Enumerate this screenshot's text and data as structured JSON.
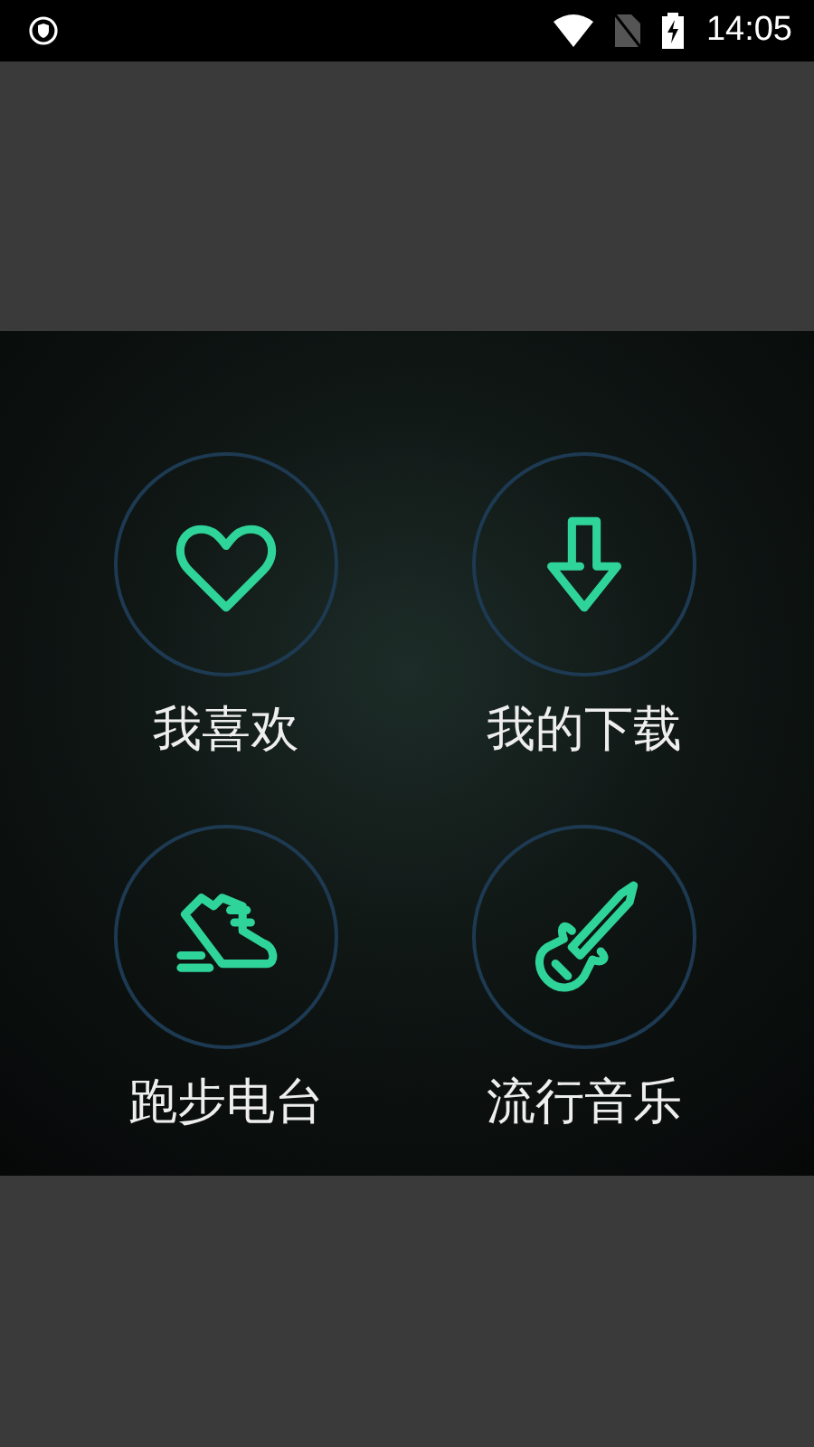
{
  "status_bar": {
    "time": "14:05"
  },
  "menu": [
    {
      "label": "我喜欢",
      "kind": "heart"
    },
    {
      "label": "我的下载",
      "kind": "download"
    },
    {
      "label": "跑步电台",
      "kind": "shoe"
    },
    {
      "label": "流行音乐",
      "kind": "guitar"
    }
  ]
}
